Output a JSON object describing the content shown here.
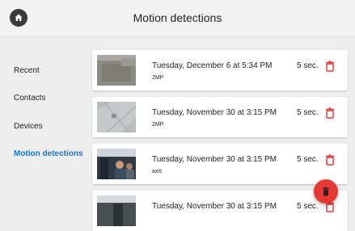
{
  "header": {
    "title": "Motion detections",
    "home_icon": "home-icon"
  },
  "sidebar": {
    "items": [
      {
        "label": "Recent",
        "active": false
      },
      {
        "label": "Contacts",
        "active": false
      },
      {
        "label": "Devices",
        "active": false
      },
      {
        "label": "Motion detections",
        "active": true
      }
    ]
  },
  "detections": [
    {
      "date": "Tuesday, December 6 at 5:34 PM",
      "source": "2MP",
      "duration": "5 sec."
    },
    {
      "date": "Tuesday, November 30 at 3:15 PM",
      "source": "2MP",
      "duration": "5 sec."
    },
    {
      "date": "Tuesday, November 30 at 3:15 PM",
      "source": "axis",
      "duration": "5 sec."
    },
    {
      "date": "Tuesday, November 30 at 3:15 PM",
      "source": "",
      "duration": "5 sec."
    }
  ],
  "icons": {
    "delete": "trash-icon",
    "fab": "delete-icon"
  },
  "colors": {
    "accent": "#1976d2",
    "danger": "#e53935",
    "fab": "#e53935"
  }
}
